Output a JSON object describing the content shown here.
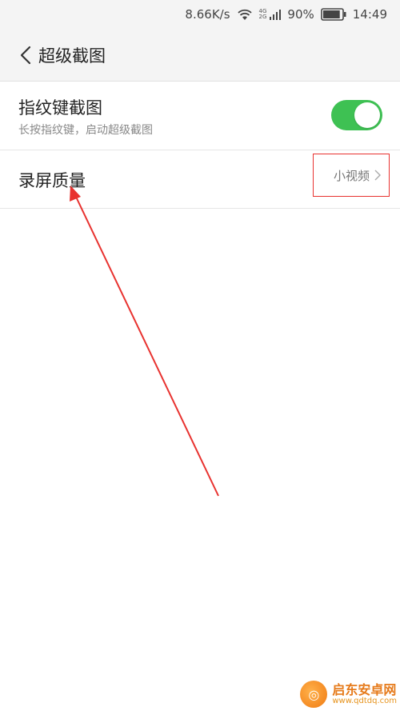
{
  "status_bar": {
    "speed": "8.66K/s",
    "net_top": "4G",
    "net_bottom": "2G",
    "battery": "90%",
    "time": "14:49",
    "battery_fraction": 0.9
  },
  "header": {
    "title": "超级截图"
  },
  "settings": {
    "fingerprint": {
      "title": "指纹键截图",
      "subtitle": "长按指纹键，启动超级截图",
      "enabled": true
    },
    "quality": {
      "title": "录屏质量",
      "value": "小视频"
    }
  },
  "watermark": {
    "name": "启东安卓网",
    "url": "www.qdtdq.com"
  },
  "colors": {
    "toggle_on": "#3ec153",
    "annotation_red": "#e8322f",
    "header_bg": "#f4f4f4"
  }
}
